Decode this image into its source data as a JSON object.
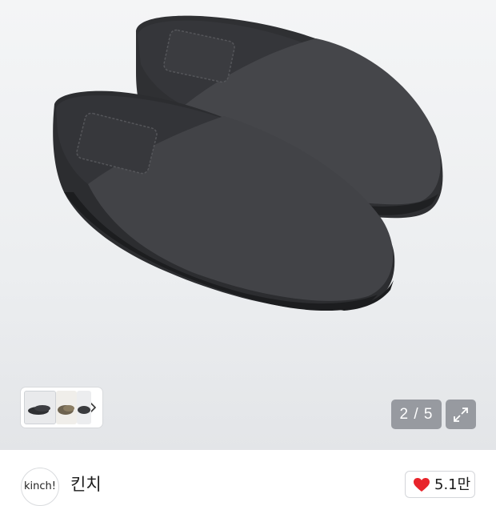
{
  "gallery": {
    "image_alt": "dark grey suede slippers",
    "counter": "2 / 5",
    "thumbnail_count": 3
  },
  "icons": {
    "next": "chevron-right-icon",
    "expand": "expand-icon",
    "like": "heart-icon"
  },
  "seller": {
    "avatar_text": "kinch!",
    "name": "킨치"
  },
  "like": {
    "count": "5.1만"
  },
  "colors": {
    "heart": "#e8242b",
    "counter_bg": "#787d84",
    "slipper": "#3f4043"
  }
}
